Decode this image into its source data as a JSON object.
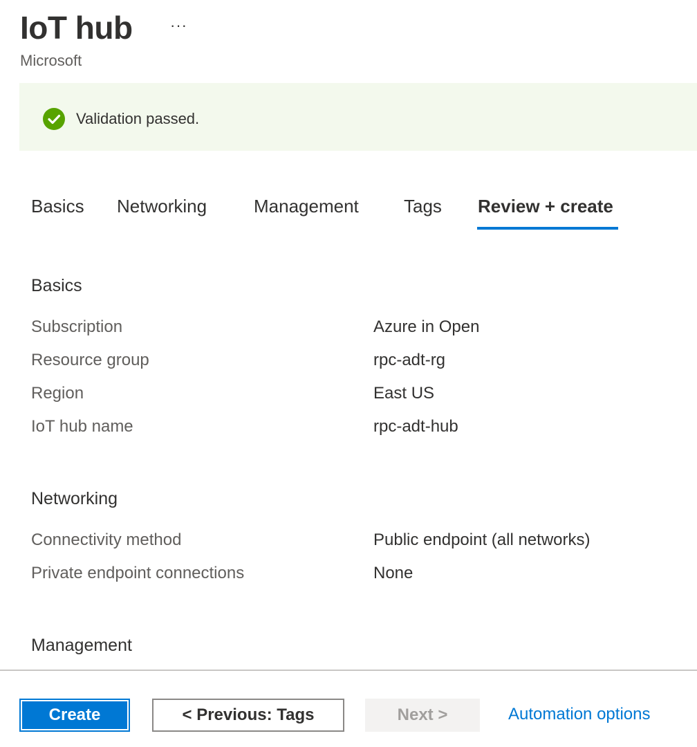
{
  "header": {
    "title": "IoT hub",
    "more_label": "···",
    "subtitle": "Microsoft"
  },
  "banner": {
    "icon": "check-circle-icon",
    "message": "Validation passed.",
    "background": "#f3f9ed",
    "icon_color": "#57a300"
  },
  "tabs": [
    {
      "label": "Basics",
      "active": false
    },
    {
      "label": "Networking",
      "active": false
    },
    {
      "label": "Management",
      "active": false
    },
    {
      "label": "Tags",
      "active": false
    },
    {
      "label": "Review + create",
      "active": true
    }
  ],
  "sections": {
    "basics": {
      "title": "Basics",
      "rows": [
        {
          "label": "Subscription",
          "value": "Azure in Open"
        },
        {
          "label": "Resource group",
          "value": "rpc-adt-rg"
        },
        {
          "label": "Region",
          "value": "East US"
        },
        {
          "label": "IoT hub name",
          "value": "rpc-adt-hub"
        }
      ]
    },
    "networking": {
      "title": "Networking",
      "rows": [
        {
          "label": "Connectivity method",
          "value": "Public endpoint (all networks)"
        },
        {
          "label": "Private endpoint connections",
          "value": "None"
        }
      ]
    },
    "management": {
      "title": "Management"
    }
  },
  "footer": {
    "create_label": "Create",
    "previous_label": "< Previous: Tags",
    "next_label": "Next >",
    "automation_label": "Automation options"
  },
  "colors": {
    "accent": "#0078d4",
    "success": "#57a300"
  }
}
